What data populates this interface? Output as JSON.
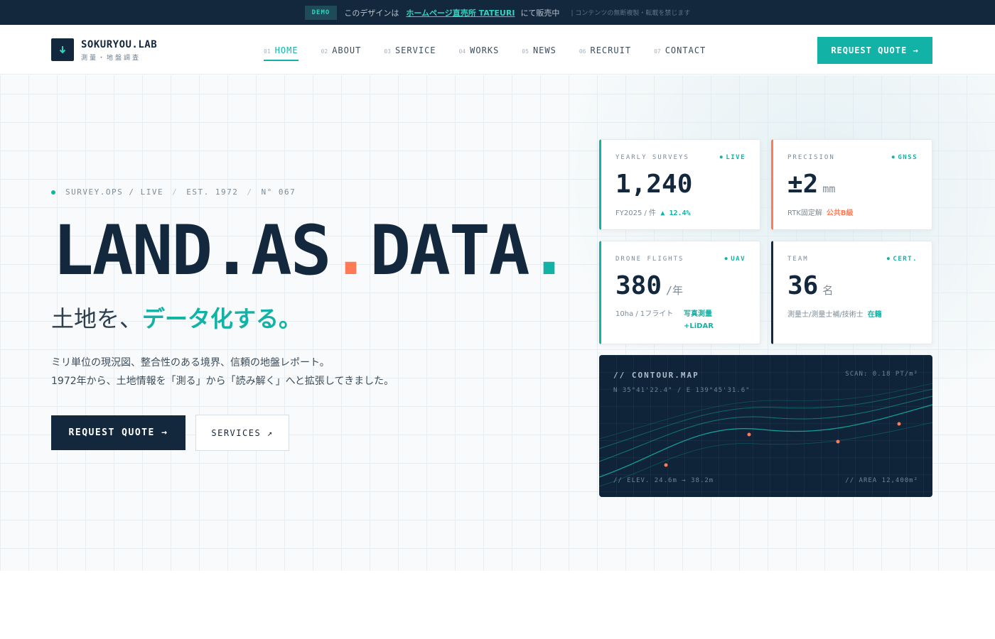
{
  "demo_bar": {
    "badge": "DEMO",
    "text": "このデザインは",
    "link": "ホームページ直売所 TATEURI",
    "suffix": "にて販売中",
    "note": "| コンテンツの無断複製・転載を禁じます"
  },
  "header": {
    "logo_name": "SOKURYOU.LAB",
    "logo_sub": "測量・地盤調査",
    "nav": [
      {
        "num": "01",
        "label": "HOME",
        "active": true
      },
      {
        "num": "02",
        "label": "ABOUT"
      },
      {
        "num": "03",
        "label": "SERVICE"
      },
      {
        "num": "04",
        "label": "WORKS"
      },
      {
        "num": "05",
        "label": "NEWS"
      },
      {
        "num": "06",
        "label": "RECRUIT"
      },
      {
        "num": "07",
        "label": "CONTACT"
      }
    ],
    "cta": "REQUEST QUOTE →"
  },
  "hero": {
    "eyebrow": [
      "SURVEY.OPS / LIVE",
      "EST. 1972",
      "N° 067"
    ],
    "eyebrow_sep": "/",
    "headline": {
      "w1": "LAND",
      "d1": ".",
      "w2": "AS",
      "d2": ".",
      "w3": "DATA",
      "d3": "."
    },
    "subtitle_plain": "土地を、",
    "subtitle_accent": "データ化する。",
    "desc_line1": "ミリ単位の現況図、整合性のある境界、信頼の地盤レポート。",
    "desc_line2": "1972年から、土地情報を「測る」から「読み解く」へと拡張してきました。",
    "btn_primary": "REQUEST QUOTE →",
    "btn_secondary": "SERVICES ↗"
  },
  "stats": {
    "yearly": {
      "label": "YEARLY SURVEYS",
      "badge": "LIVE",
      "value": "1,240",
      "foot": "FY2025 / 件",
      "trend": "▲ 12.4%"
    },
    "precision": {
      "label": "PRECISION",
      "badge": "GNSS",
      "value": "±2",
      "unit": "mm",
      "foot": "RTK固定解",
      "foot_accent": "公共B級"
    },
    "drone": {
      "label": "DRONE FLIGHTS",
      "badge": "UAV",
      "value": "380",
      "unit": "/年",
      "foot": "10ha / 1フライト",
      "foot_accent": "写真測量+LiDAR"
    },
    "team": {
      "label": "TEAM",
      "badge": "CERT.",
      "value": "36",
      "unit": "名",
      "foot": "測量士/測量士補/技術士",
      "foot_accent": "在籍"
    }
  },
  "map": {
    "title": "// CONTOUR.MAP",
    "scan": "SCAN: 0.18 PT/m²",
    "coord": "N 35°41'22.4\" / E 139°45'31.6\"",
    "elev": "// ELEV. 24.6m → 38.2m",
    "area": "// AREA 12,400m²"
  },
  "colors": {
    "accent": "#12b3a6",
    "navy": "#14283d",
    "orange": "#ff7a55"
  },
  "icons": {
    "logo": "arrow-down-icon"
  }
}
